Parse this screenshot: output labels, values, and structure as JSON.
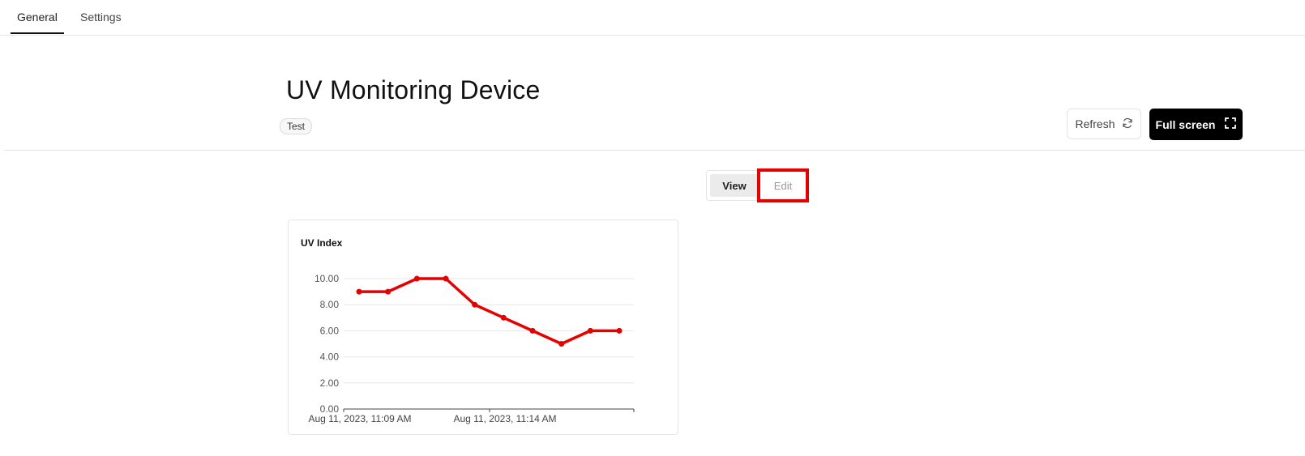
{
  "tabs": [
    {
      "label": "General",
      "active": true
    },
    {
      "label": "Settings",
      "active": false
    }
  ],
  "page": {
    "title": "UV Monitoring Device",
    "tag": "Test"
  },
  "actions": {
    "refresh_label": "Refresh",
    "fullscreen_label": "Full screen"
  },
  "mode_toggle": {
    "view_label": "View",
    "edit_label": "Edit",
    "selected": "View",
    "highlight_color": "#e60000"
  },
  "chart_card": {
    "title": "UV Index"
  },
  "chart_data": {
    "type": "line",
    "title": "UV Index",
    "series": [
      {
        "color": "#e60000",
        "values": [
          9,
          9,
          10,
          10,
          8,
          7,
          6,
          5,
          6,
          6
        ]
      }
    ],
    "ylim": [
      0,
      10
    ],
    "yticks": [
      "0.00",
      "2.00",
      "4.00",
      "6.00",
      "8.00",
      "10.00"
    ],
    "xtick_labels": [
      "Aug 11, 2023, 11:09 AM",
      "Aug 11, 2023, 11:14 AM"
    ],
    "grid": true
  }
}
